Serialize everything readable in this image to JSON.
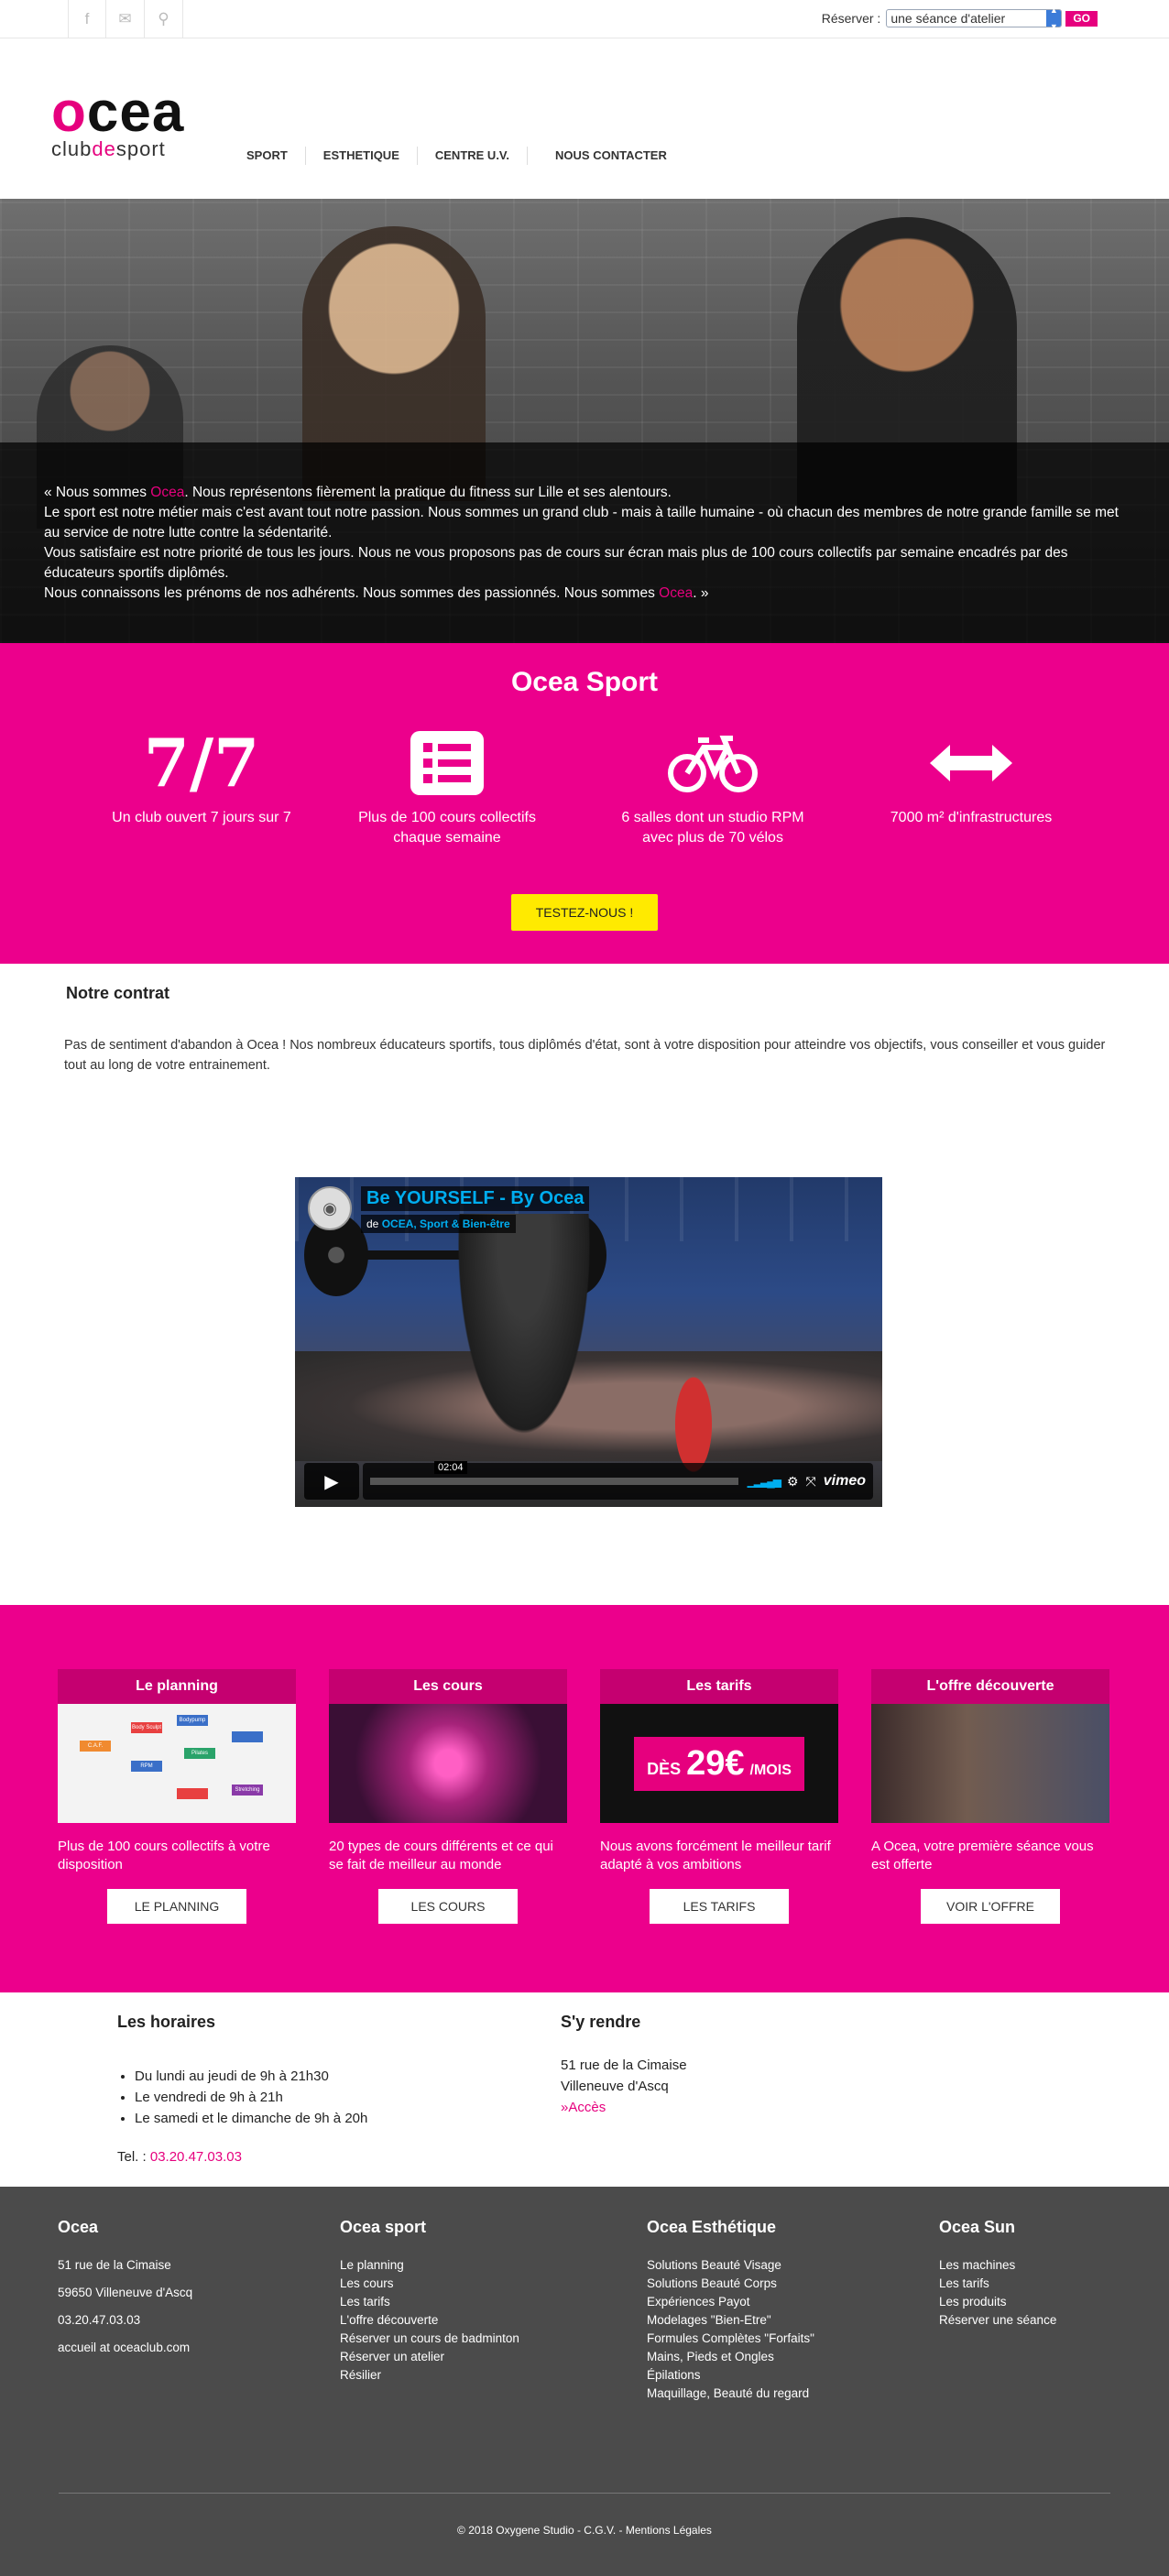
{
  "topbar": {
    "icons": [
      "facebook-icon",
      "mail-icon",
      "location-icon"
    ],
    "reserve_label": "Réserver :",
    "reserve_value": "une séance d'atelier",
    "go_label": "GO"
  },
  "logo": {
    "word": "ocea",
    "tagline_pre": "club",
    "tagline_mid": "de",
    "tagline_post": "sport"
  },
  "nav": [
    "SPORT",
    "ESTHETIQUE",
    "CENTRE U.V.",
    "NOUS CONTACTER"
  ],
  "hero": {
    "l1a": "« Nous sommes ",
    "brand": "Ocea",
    "l1b": ". Nous représentons fièrement la pratique du fitness sur Lille et ses alentours.",
    "l2": "Le sport est notre métier mais c'est avant tout notre passion. Nous sommes un grand club - mais à taille humaine - où chacun des membres de notre grande famille se met au service de notre lutte contre la sédentarité.",
    "l3": "Vous satisfaire est notre priorité de tous les jours. Nous ne vous proposons pas de cours sur écran mais plus de 100 cours collectifs par semaine encadrés par des éducateurs sportifs diplômés.",
    "l4a": "Nous connaissons les prénoms de nos adhérents. Nous sommes des passionnés. Nous sommes ",
    "l4b": ". »"
  },
  "sport": {
    "title": "Ocea Sport",
    "big_number": "7/7",
    "features": [
      "Un club ouvert 7 jours sur 7",
      "Plus de 100 cours collectifs chaque semaine",
      "6 salles dont un studio RPM avec plus de 70 vélos",
      "7000 m² d'infrastructures"
    ],
    "cta": "TESTEZ-NOUS !"
  },
  "contrat": {
    "title": "Notre contrat",
    "text": "Pas de sentiment d'abandon à Ocea ! Nos nombreux éducateurs sportifs, tous diplômés d'état, sont à votre disposition pour atteindre vos objectifs, vous conseiller et vous guider tout au long de votre entrainement."
  },
  "video": {
    "title": "Be YOURSELF - By Ocea",
    "by": "de",
    "channel": "OCEA, Sport & Bien-être",
    "time": "02:04",
    "brand": "vimeo"
  },
  "cards": [
    {
      "title": "Le planning",
      "desc": "Plus de 100 cours collectifs à votre disposition",
      "button": "LE PLANNING"
    },
    {
      "title": "Les cours",
      "desc": "20 types de cours différents et ce qui se fait de meilleur au monde",
      "button": "LES COURS"
    },
    {
      "title": "Les tarifs",
      "desc": "Nous avons forcément le meilleur tarif adapté à vos ambitions",
      "button": "LES TARIFS"
    },
    {
      "title": "L'offre découverte",
      "desc": "A Ocea, votre première séance vous est offerte",
      "button": "VOIR L'OFFRE"
    }
  ],
  "tarif_banner": {
    "a": "DÈS",
    "b": "29€",
    "c": "/MOIS"
  },
  "planning_tags": [
    "Body Sculpt",
    "Bodypump",
    "C.A.F.",
    "RPM",
    "Pilates",
    "Stretching"
  ],
  "horaires": {
    "title": "Les horaires",
    "items": [
      "Du lundi au jeudi de 9h à 21h30",
      "Le vendredi de 9h à 21h",
      "Le samedi et le dimanche de 9h à 20h"
    ],
    "tel_label": "Tel. :",
    "tel": "03.20.47.03.03"
  },
  "rendre": {
    "title": "S'y rendre",
    "street": "51 rue de la Cimaise",
    "city": "Villeneuve d'Ascq",
    "acces_prefix": "»",
    "acces": "Accès"
  },
  "footer": {
    "c1": {
      "title": "Ocea",
      "items": [
        "51 rue de la Cimaise",
        "59650 Villeneuve d'Ascq",
        "03.20.47.03.03",
        "accueil at oceaclub.com"
      ]
    },
    "c2": {
      "title": "Ocea sport",
      "items": [
        "Le planning",
        "Les cours",
        "Les tarifs",
        "L'offre découverte",
        "Réserver un cours de badminton",
        "Réserver un atelier",
        "Résilier"
      ]
    },
    "c3": {
      "title": "Ocea Esthétique",
      "items": [
        "Solutions Beauté Visage",
        "Solutions Beauté Corps",
        "Expériences Payot",
        "Modelages \"Bien-Etre\"",
        "Formules Complètes \"Forfaits\"",
        "Mains, Pieds et Ongles",
        "Épilations",
        "Maquillage, Beauté du regard"
      ]
    },
    "c4": {
      "title": "Ocea Sun",
      "items": [
        "Les machines",
        "Les tarifs",
        "Les produits",
        "Réserver une séance"
      ]
    },
    "copyright": "© 2018 Oxygene Studio - C.G.V. - Mentions Légales"
  },
  "colors": {
    "accent": "#ec008c",
    "yellow": "#ffea00",
    "footer": "#4b4b4b"
  }
}
